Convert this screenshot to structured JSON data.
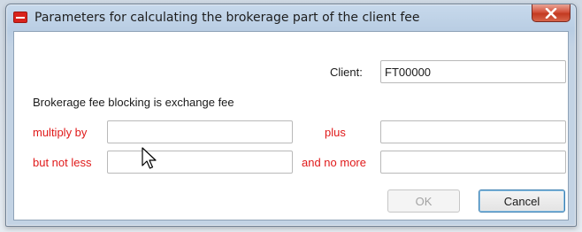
{
  "window": {
    "title": "Parameters for calculating the brokerage part of the client fee",
    "close_icon": "close-icon"
  },
  "form": {
    "client_label": "Client:",
    "client_value": "FT00000",
    "section_label": "Brokerage fee blocking is exchange fee",
    "multiply_label": "multiply by",
    "multiply_value": "",
    "plus_label": "plus",
    "plus_value": "",
    "not_less_label": "but not less",
    "not_less_value": "",
    "no_more_label": "and no more",
    "no_more_value": ""
  },
  "buttons": {
    "ok_label": "OK",
    "cancel_label": "Cancel"
  },
  "colors": {
    "label_red": "#e01a1a",
    "cancel_border": "#3c7fb1"
  }
}
